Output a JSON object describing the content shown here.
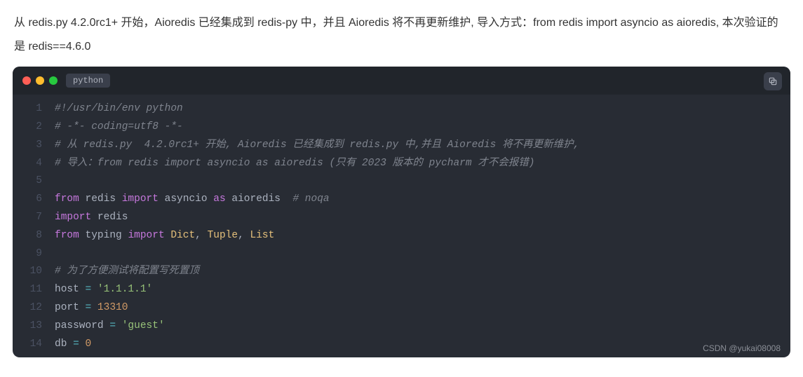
{
  "description": "从 redis.py 4.2.0rc1+ 开始，Aioredis 已经集成到 redis-py 中，并且 Aioredis 将不再更新维护, 导入方式：from redis import asyncio as aioredis, 本次验证的是 redis==4.6.0",
  "tab_label": "python",
  "watermark": "CSDN @yukai08008",
  "code": {
    "l1": {
      "ln": "1",
      "t1": "#!/usr/bin/env python"
    },
    "l2": {
      "ln": "2",
      "t1": "# -*- coding=utf8 -*-"
    },
    "l3": {
      "ln": "3",
      "t1": "# 从 redis.py  4.2.0rc1+ 开始, Aioredis 已经集成到 redis.py 中,并且 Aioredis 将不再更新维护,"
    },
    "l4": {
      "ln": "4",
      "t1": "# 导入：from redis import asyncio as aioredis (只有 2023 版本的 pycharm 才不会报错)"
    },
    "l5": {
      "ln": "5",
      "t1": ""
    },
    "l6": {
      "ln": "6",
      "k1": "from",
      "n1": " redis ",
      "k2": "import",
      "n2": " asyncio ",
      "k3": "as",
      "n3": " aioredis  ",
      "c1": "# noqa"
    },
    "l7": {
      "ln": "7",
      "k1": "import",
      "n1": " redis"
    },
    "l8": {
      "ln": "8",
      "k1": "from",
      "n1": " typing ",
      "k2": "import",
      "c1": " Dict",
      "p1": ", ",
      "c2": "Tuple",
      "p2": ", ",
      "c3": "List"
    },
    "l9": {
      "ln": "9",
      "t1": ""
    },
    "l10": {
      "ln": "10",
      "t1": "# 为了方便测试将配置写死置顶"
    },
    "l11": {
      "ln": "11",
      "n1": "host ",
      "op": "=",
      "s1": " '1.1.1.1'"
    },
    "l12": {
      "ln": "12",
      "n1": "port ",
      "op": "=",
      "num": " 13310"
    },
    "l13": {
      "ln": "13",
      "n1": "password ",
      "op": "=",
      "s1": " 'guest'"
    },
    "l14": {
      "ln": "14",
      "n1": "db ",
      "op": "=",
      "num": " 0"
    }
  }
}
